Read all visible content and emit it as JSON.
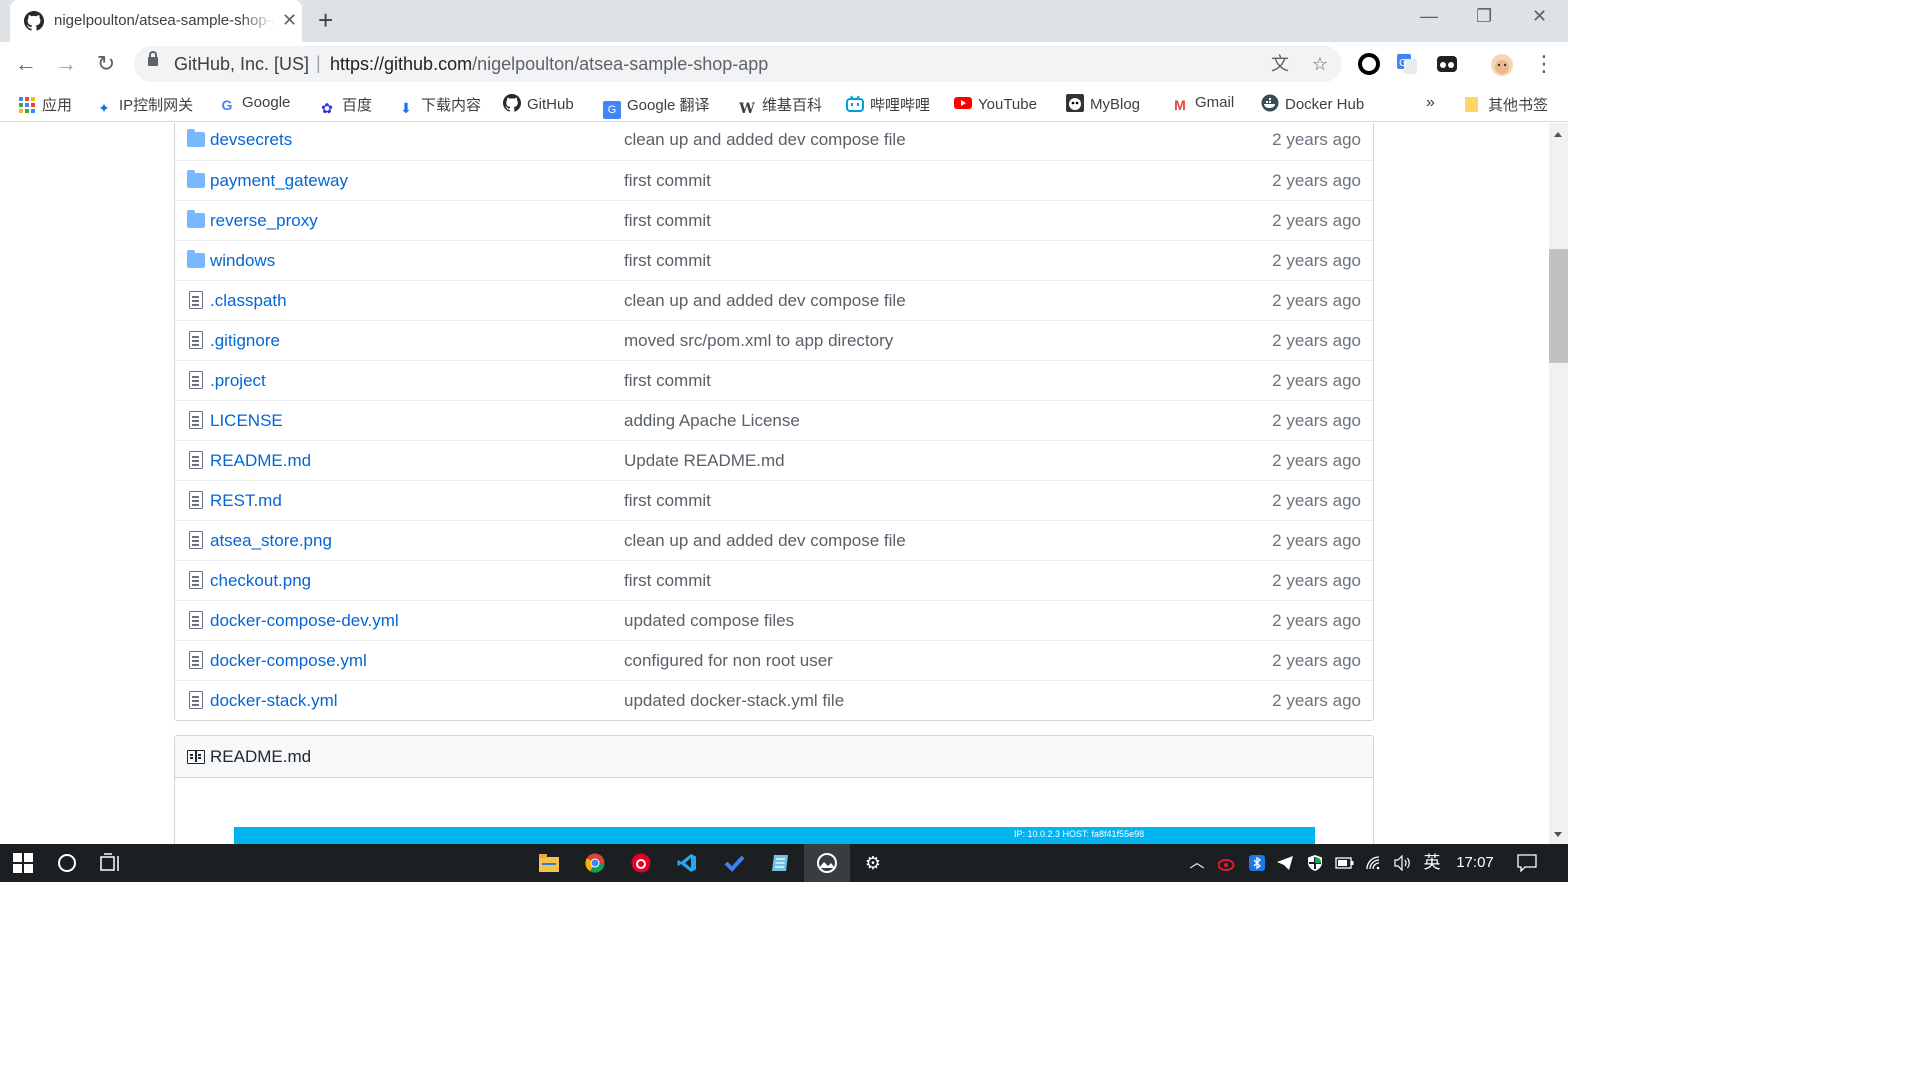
{
  "browser": {
    "tab_title": "nigelpoulton/atsea-sample-shop-app",
    "omnibox": {
      "site_identity": "GitHub, Inc. [US]",
      "url_scheme_host": "https://github.com",
      "url_path": "/nigelpoulton/atsea-sample-shop-app"
    }
  },
  "bookmarks": [
    {
      "label": "应用",
      "icon": "apps-grid-icon"
    },
    {
      "label": "IP控制网关",
      "icon": "network-icon"
    },
    {
      "label": "Google",
      "icon": "google-icon"
    },
    {
      "label": "百度",
      "icon": "baidu-icon"
    },
    {
      "label": "下载内容",
      "icon": "download-icon"
    },
    {
      "label": "GitHub",
      "icon": "github-icon"
    },
    {
      "label": "Google 翻译",
      "icon": "translate-icon"
    },
    {
      "label": "维基百科",
      "icon": "wikipedia-icon"
    },
    {
      "label": "哔哩哔哩",
      "icon": "bilibili-icon"
    },
    {
      "label": "YouTube",
      "icon": "youtube-icon"
    },
    {
      "label": "MyBlog",
      "icon": "blog-icon"
    },
    {
      "label": "Gmail",
      "icon": "gmail-icon"
    },
    {
      "label": "Docker Hub",
      "icon": "docker-icon"
    }
  ],
  "bookmarks_overflow": "»",
  "other_bookmarks": "其他书签",
  "files": [
    {
      "name": "devsecrets",
      "type": "folder",
      "message": "clean up and added dev compose file",
      "age": "2 years ago"
    },
    {
      "name": "payment_gateway",
      "type": "folder",
      "message": "first commit",
      "age": "2 years ago"
    },
    {
      "name": "reverse_proxy",
      "type": "folder",
      "message": "first commit",
      "age": "2 years ago"
    },
    {
      "name": "windows",
      "type": "folder",
      "message": "first commit",
      "age": "2 years ago"
    },
    {
      "name": ".classpath",
      "type": "file",
      "message": "clean up and added dev compose file",
      "age": "2 years ago"
    },
    {
      "name": ".gitignore",
      "type": "file",
      "message": "moved src/pom.xml to app directory",
      "age": "2 years ago"
    },
    {
      "name": ".project",
      "type": "file",
      "message": "first commit",
      "age": "2 years ago"
    },
    {
      "name": "LICENSE",
      "type": "file",
      "message": "adding Apache License",
      "age": "2 years ago"
    },
    {
      "name": "README.md",
      "type": "file",
      "message": "Update README.md",
      "age": "2 years ago"
    },
    {
      "name": "REST.md",
      "type": "file",
      "message": "first commit",
      "age": "2 years ago"
    },
    {
      "name": "atsea_store.png",
      "type": "file",
      "message": "clean up and added dev compose file",
      "age": "2 years ago"
    },
    {
      "name": "checkout.png",
      "type": "file",
      "message": "first commit",
      "age": "2 years ago"
    },
    {
      "name": "docker-compose-dev.yml",
      "type": "file",
      "message": "updated compose files",
      "age": "2 years ago"
    },
    {
      "name": "docker-compose.yml",
      "type": "file",
      "message": "configured for non root user",
      "age": "2 years ago"
    },
    {
      "name": "docker-stack.yml",
      "type": "file",
      "message": "updated docker-stack.yml file",
      "age": "2 years ago"
    }
  ],
  "readme": {
    "title": "README.md",
    "banner_text": "IP: 10.0.2.3 HOST: fa8f41f55e98"
  },
  "taskbar": {
    "ime": "英",
    "clock": "17:07"
  },
  "colors": {
    "link": "#0366d6",
    "folder": "#79b8ff",
    "banner": "#00b4f0"
  }
}
